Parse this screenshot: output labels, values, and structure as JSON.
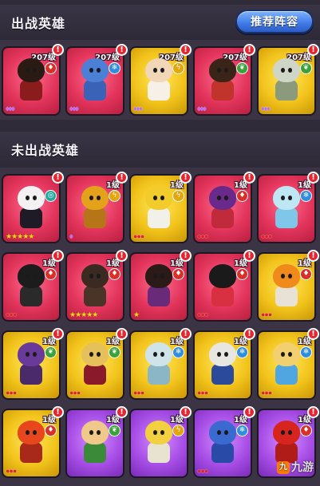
{
  "deployed": {
    "title": "出战英雄",
    "recommend_label": "推荐阵容",
    "heroes": [
      {
        "level": "207级",
        "color": "pink",
        "element": "fire",
        "element_glyph": "♦",
        "rank": "♦♦♦",
        "rank_style": "gem",
        "hero": "samurai-hero-icon",
        "head": "#2a1a14",
        "body": "#8a1c1c"
      },
      {
        "level": "207级",
        "color": "pink",
        "element": "ice",
        "element_glyph": "❄",
        "rank": "♦♦♦",
        "rank_style": "gem",
        "hero": "spiky-beast-hero-icon",
        "head": "#4c7fd6",
        "body": "#3a63b8"
      },
      {
        "level": "207级",
        "color": "yellow",
        "element": "thunder",
        "element_glyph": "ϟ",
        "rank": "♦♦♦",
        "rank_style": "gem",
        "hero": "angel-hero-icon",
        "head": "#f1d6b8",
        "body": "#f6f0e6"
      },
      {
        "level": "207级",
        "color": "pink",
        "element": "nature",
        "element_glyph": "❦",
        "rank": "♦♦♦",
        "rank_style": "gem",
        "hero": "amazon-hero-icon",
        "head": "#3a2418",
        "body": "#c0342b"
      },
      {
        "level": "207级",
        "color": "yellow",
        "element": "nature",
        "element_glyph": "❦",
        "rank": "♦♦♦",
        "rank_style": "gem",
        "hero": "golem-hero-icon",
        "head": "#cfd6c8",
        "body": "#8a9a7a"
      }
    ]
  },
  "undeployed": {
    "title": "未出战英雄",
    "heroes": [
      {
        "level": "",
        "color": "pink",
        "element": "arcane",
        "element_glyph": "◎",
        "rank": "★★★★★",
        "rank_style": "gold",
        "hero": "witch-hero-icon",
        "head": "#f4f1f3",
        "body": "#1e1a26"
      },
      {
        "level": "1级",
        "color": "pink",
        "element": "thunder",
        "element_glyph": "ϟ",
        "rank": "♦",
        "rank_style": "gem",
        "hero": "boxer-robot-hero-icon",
        "head": "#e3a21a",
        "body": "#b7751a"
      },
      {
        "level": "1级",
        "color": "yellow",
        "element": "thunder",
        "element_glyph": "ϟ",
        "rank": "●●●",
        "rank_style": "drop",
        "hero": "pharaoh-hero-icon",
        "head": "#f2cc2a",
        "body": "#f1f1ea"
      },
      {
        "level": "1级",
        "color": "pink",
        "element": "fire",
        "element_glyph": "♦",
        "rank": "●●●",
        "rank_style": "drop",
        "hero": "swordsman-hero-icon",
        "head": "#6a2a8c",
        "body": "#c02a3a"
      },
      {
        "level": "1级",
        "color": "pink",
        "element": "ice",
        "element_glyph": "❄",
        "rank": "●●●",
        "rank_style": "drop",
        "hero": "ice-queen-hero-icon",
        "head": "#bfe6f4",
        "body": "#7fc7e8"
      },
      {
        "level": "1级",
        "color": "pink",
        "element": "fire",
        "element_glyph": "♦",
        "rank": "●●●",
        "rank_style": "drop",
        "hero": "zorro-hero-icon",
        "head": "#1c1c1c",
        "body": "#2a2a2a"
      },
      {
        "level": "1级",
        "color": "pink",
        "element": "fire",
        "element_glyph": "♦",
        "rank": "★★★★★",
        "rank_style": "gold",
        "hero": "ninja-hero-icon",
        "head": "#3a2a22",
        "body": "#4a3428"
      },
      {
        "level": "1级",
        "color": "pink",
        "element": "fire",
        "element_glyph": "♦",
        "rank": "★",
        "rank_style": "gold",
        "hero": "monk-hero-icon",
        "head": "#2a1a18",
        "body": "#6a2a7a"
      },
      {
        "level": "1级",
        "color": "pink",
        "element": "fire",
        "element_glyph": "♦",
        "rank": "●●●",
        "rank_style": "drop",
        "hero": "kungfu-girl-hero-icon",
        "head": "#1a1a1a",
        "body": "#d83040"
      },
      {
        "level": "1级",
        "color": "yellow",
        "element": "fire",
        "element_glyph": "♦",
        "rank": "●●●",
        "rank_style": "drop",
        "hero": "bazooka-hero-icon",
        "head": "#f08a1a",
        "body": "#e8e2d6"
      },
      {
        "level": "1级",
        "color": "yellow",
        "element": "nature",
        "element_glyph": "❦",
        "rank": "●●●",
        "rank_style": "drop",
        "hero": "hooded-mage-hero-icon",
        "head": "#6a3a9a",
        "body": "#4a2a6a"
      },
      {
        "level": "1级",
        "color": "yellow",
        "element": "nature",
        "element_glyph": "❦",
        "rank": "●●●",
        "rank_style": "drop",
        "hero": "vampire-hero-icon",
        "head": "#e6c05a",
        "body": "#8a1a2a"
      },
      {
        "level": "1级",
        "color": "yellow",
        "element": "ice",
        "element_glyph": "❄",
        "rank": "●●●",
        "rank_style": "drop",
        "hero": "mummy-hero-icon",
        "head": "#cfe4ea",
        "body": "#8ab6c6"
      },
      {
        "level": "1级",
        "color": "yellow",
        "element": "ice",
        "element_glyph": "❄",
        "rank": "●●●",
        "rank_style": "drop",
        "hero": "wizard-hero-icon",
        "head": "#e8e6e0",
        "body": "#2c4a9a"
      },
      {
        "level": "1级",
        "color": "yellow",
        "element": "ice",
        "element_glyph": "❄",
        "rank": "●●●",
        "rank_style": "drop",
        "hero": "priestess-hero-icon",
        "head": "#f2d070",
        "body": "#4fa6e0"
      },
      {
        "level": "1级",
        "color": "yellow",
        "element": "fire",
        "element_glyph": "♦",
        "rank": "●●●",
        "rank_style": "drop",
        "hero": "fire-spirit-hero-icon",
        "head": "#e8461c",
        "body": "#a8281a"
      },
      {
        "level": "1级",
        "color": "purple",
        "element": "nature",
        "element_glyph": "❦",
        "rank": "",
        "rank_style": "drop",
        "hero": "elf-archer-hero-icon",
        "head": "#f0c98a",
        "body": "#3a8a3a"
      },
      {
        "level": "1级",
        "color": "purple",
        "element": "thunder",
        "element_glyph": "ϟ",
        "rank": "",
        "rank_style": "drop",
        "hero": "brawler-hero-icon",
        "head": "#f2d040",
        "body": "#e8e2d0"
      },
      {
        "level": "1级",
        "color": "purple",
        "element": "ice",
        "element_glyph": "❄",
        "rank": "●●●",
        "rank_style": "drop",
        "hero": "blue-mage-hero-icon",
        "head": "#3a6ad0",
        "body": "#2a4aa8"
      },
      {
        "level": "1级",
        "color": "purple",
        "element": "fire",
        "element_glyph": "♦",
        "rank": "",
        "rank_style": "drop",
        "hero": "red-wizard-hero-icon",
        "head": "#d8241e",
        "body": "#b01c18"
      }
    ]
  },
  "alert_glyph": "!",
  "watermark": {
    "icon": "九",
    "text": "九游"
  }
}
